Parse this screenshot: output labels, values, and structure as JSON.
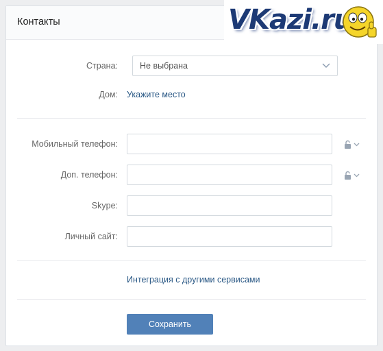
{
  "header": {
    "title": "Контакты"
  },
  "watermark": {
    "text": "VKazi.ru"
  },
  "form": {
    "country": {
      "label": "Страна:",
      "value": "Не выбрана"
    },
    "home": {
      "label": "Дом:",
      "link": "Укажите место"
    },
    "mobile_phone": {
      "label": "Мобильный телефон:",
      "value": ""
    },
    "extra_phone": {
      "label": "Доп. телефон:",
      "value": ""
    },
    "skype": {
      "label": "Skype:",
      "value": ""
    },
    "website": {
      "label": "Личный сайт:",
      "value": ""
    },
    "integration_link": "Интеграция с другими сервисами",
    "save_label": "Сохранить"
  },
  "colors": {
    "accent": "#5181b8",
    "link": "#2a5885",
    "label": "#656565"
  }
}
